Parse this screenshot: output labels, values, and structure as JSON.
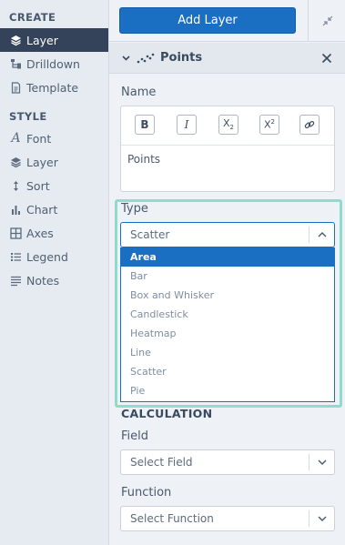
{
  "sidebar": {
    "sections": [
      {
        "heading": "CREATE",
        "items": [
          {
            "label": "Layer",
            "icon": "layers-icon",
            "active": true
          },
          {
            "label": "Drilldown",
            "icon": "drilldown-icon"
          },
          {
            "label": "Template",
            "icon": "template-icon"
          }
        ]
      },
      {
        "heading": "STYLE",
        "items": [
          {
            "label": "Font",
            "icon": "font-icon"
          },
          {
            "label": "Layer",
            "icon": "layers-icon"
          },
          {
            "label": "Sort",
            "icon": "sort-icon"
          },
          {
            "label": "Chart",
            "icon": "chart-icon"
          },
          {
            "label": "Axes",
            "icon": "axes-icon"
          },
          {
            "label": "Legend",
            "icon": "legend-icon"
          },
          {
            "label": "Notes",
            "icon": "notes-icon"
          }
        ]
      }
    ]
  },
  "toolbar": {
    "add_layer_label": "Add Layer"
  },
  "layer": {
    "title": "Points",
    "name_label": "Name",
    "name_value": "Points",
    "format_buttons": [
      "B",
      "I",
      "X2",
      "X2",
      "link"
    ],
    "type_label": "Type",
    "type_value": "Scatter",
    "type_options": [
      "Area",
      "Bar",
      "Box and Whisker",
      "Candlestick",
      "Heatmap",
      "Line",
      "Scatter",
      "Pie"
    ],
    "type_highlighted": "Area"
  },
  "calculation": {
    "heading": "CALCULATION",
    "field_label": "Field",
    "field_placeholder": "Select Field",
    "function_label": "Function",
    "function_placeholder": "Select Function"
  },
  "colors": {
    "accent": "#1a6fc3",
    "sidebar_active": "#35435a",
    "highlight": "#8fdccd"
  }
}
